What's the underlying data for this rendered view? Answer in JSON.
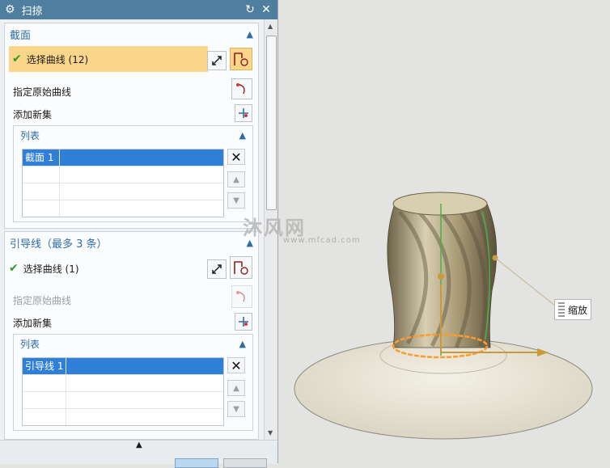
{
  "dialog": {
    "title": "扫掠",
    "section1": {
      "header": "截面",
      "select_curve": "选择曲线 (12)",
      "specify_origin": "指定原始曲线",
      "add_new_set": "添加新集",
      "list_header": "列表",
      "rows": [
        "截面 1",
        "",
        "",
        ""
      ]
    },
    "section2": {
      "header": "引导线（最多 3 条）",
      "select_curve": "选择曲线 (1)",
      "specify_origin": "指定原始曲线",
      "add_new_set": "添加新集",
      "list_header": "列表",
      "rows": [
        "引导线 1",
        "",
        "",
        ""
      ]
    }
  },
  "viewport": {
    "tooltip": "缩放",
    "watermark": "沐风网",
    "watermark_url": "www.mfcad.com"
  },
  "colors": {
    "titlebar": "#4f7f9f",
    "accent": "#2e6ca8",
    "highlight": "#fad58a",
    "selection": "#2f7fd6"
  }
}
